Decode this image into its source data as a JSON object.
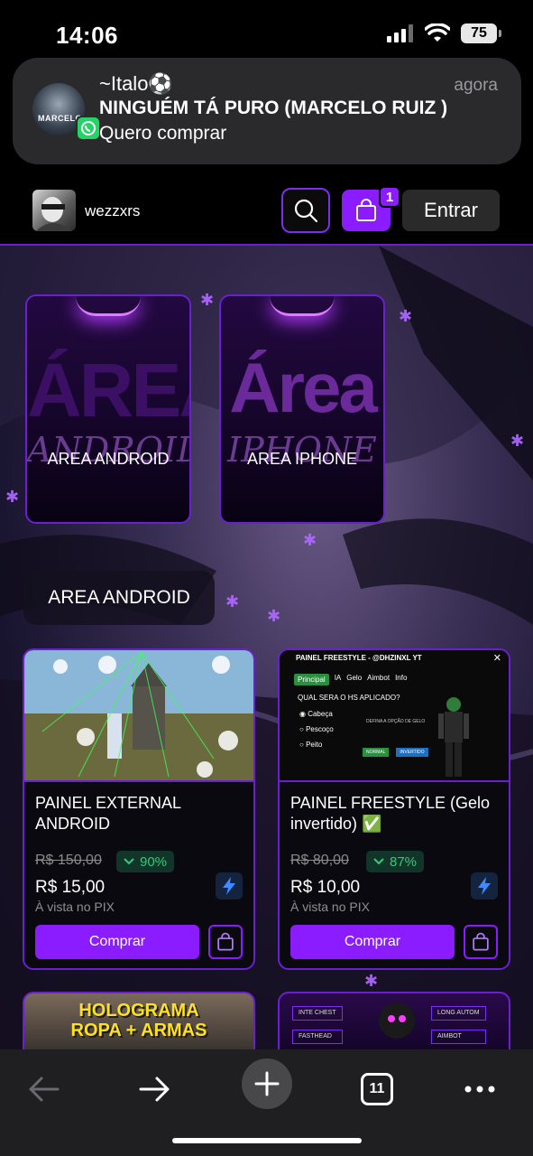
{
  "status_bar": {
    "time": "14:06",
    "battery": "75"
  },
  "notification": {
    "sender": "~Italo⚽",
    "time": "agora",
    "title": "NINGUÉM TÁ PURO (MARCELO RUIZ )",
    "message": "Quero comprar",
    "avatar_text": "MARCELO",
    "app_icon": "whatsapp-icon"
  },
  "header": {
    "site_name": "wezzxrs",
    "cart_count": "1",
    "login_label": "Entrar",
    "accent_color": "#8a1cff"
  },
  "categories": [
    {
      "big_text": "ÁREA",
      "script_text": "ANDROID",
      "label": "AREA ANDROID"
    },
    {
      "big_text": "Área",
      "script_text": "IPHONE",
      "label": "AREA IPHONE"
    }
  ],
  "section": {
    "title": "AREA ANDROID"
  },
  "products": [
    {
      "name": "PAINEL EXTERNAL ANDROID",
      "old_price": "R$ 150,00",
      "discount": "90%",
      "price": "R$ 15,00",
      "payment_note": "À vista no PIX",
      "buy_label": "Comprar"
    },
    {
      "name": "PAINEL FREESTYLE (Gelo invertido) ✅",
      "old_price": "R$ 80,00",
      "discount": "87%",
      "price": "R$ 10,00",
      "payment_note": "À vista no PIX",
      "buy_label": "Comprar",
      "panel_preview": {
        "title": "PAINEL FREESTYLE - @DHZINXL YT",
        "tabs": [
          "Principal",
          "IA",
          "Gelo",
          "Aimbot",
          "Info"
        ],
        "question": "QUAL SERA O HS APLICADO?",
        "options": [
          "Cabeça",
          "Pescoço",
          "Peito"
        ],
        "note": "DEFINA A OPÇÃO DE GELO",
        "buttons": [
          "NORMAL",
          "INVERTIDO"
        ]
      }
    }
  ],
  "peek_products": [
    {
      "banner_line1": "HOLOGRAMA",
      "banner_line2": "ROPA + ARMAS"
    },
    {
      "menu_items": [
        "INTE CHEST",
        "FASTHEAD",
        "LONG AUTOM",
        "AIMBOT"
      ]
    }
  ],
  "browser": {
    "tabs_count": "11"
  }
}
